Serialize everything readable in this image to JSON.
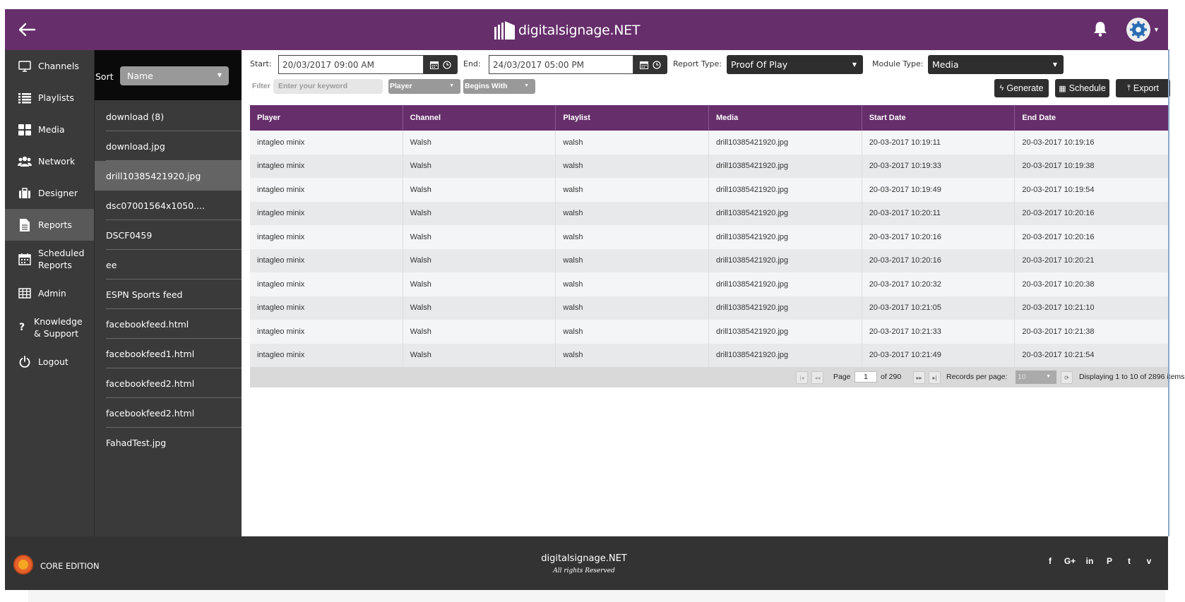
{
  "header": {
    "brand": "digitalsignage.NET"
  },
  "nav": {
    "items": [
      {
        "label": "Channels",
        "icon": "monitor-icon"
      },
      {
        "label": "Playlists",
        "icon": "list-icon"
      },
      {
        "label": "Media",
        "icon": "grid-icon"
      },
      {
        "label": "Network",
        "icon": "users-icon"
      },
      {
        "label": "Designer",
        "icon": "briefcase-icon"
      },
      {
        "label": "Reports",
        "icon": "file-icon",
        "active": true
      },
      {
        "label": "Scheduled",
        "label2": "Reports",
        "icon": "calendar-icon"
      },
      {
        "label": "Admin",
        "icon": "table-icon"
      },
      {
        "label": "Knowledge",
        "label2": "& Support",
        "icon": "question-icon"
      },
      {
        "label": "Logout",
        "icon": "power-icon"
      }
    ]
  },
  "list": {
    "sort_label": "Sort",
    "sort_value": "Name",
    "items": [
      "download (8)",
      "download.jpg",
      "drill10385421920.jpg",
      "dsc07001564x1050....",
      "DSCF0459",
      "ee",
      "ESPN Sports feed",
      "facebookfeed.html",
      "facebookfeed1.html",
      "facebookfeed2.html",
      "facebookfeed2.html",
      "FahadTest.jpg"
    ],
    "selected_index": 2
  },
  "filters": {
    "start_label": "Start:",
    "start_value": "20/03/2017 09:00 AM",
    "end_label": "End:",
    "end_value": "24/03/2017 05:00 PM",
    "report_type_label": "Report Type:",
    "report_type_value": "Proof Of Play",
    "module_type_label": "Module Type:",
    "module_type_value": "Media",
    "filter_label": "Filter",
    "filter_placeholder": "Enter your keyword",
    "field_value": "Player",
    "operator_value": "Begins With"
  },
  "actions": {
    "generate": "Generate",
    "schedule": "Schedule",
    "export": "Export"
  },
  "table": {
    "columns": [
      "Player",
      "Channel",
      "Playlist",
      "Media",
      "Start Date",
      "End Date"
    ],
    "rows": [
      [
        "intagleo minix",
        "Walsh",
        "walsh",
        "drill10385421920.jpg",
        "20-03-2017 10:19:11",
        "20-03-2017 10:19:16"
      ],
      [
        "intagleo minix",
        "Walsh",
        "walsh",
        "drill10385421920.jpg",
        "20-03-2017 10:19:33",
        "20-03-2017 10:19:38"
      ],
      [
        "intagleo minix",
        "Walsh",
        "walsh",
        "drill10385421920.jpg",
        "20-03-2017 10:19:49",
        "20-03-2017 10:19:54"
      ],
      [
        "intagleo minix",
        "Walsh",
        "walsh",
        "drill10385421920.jpg",
        "20-03-2017 10:20:11",
        "20-03-2017 10:20:16"
      ],
      [
        "intagleo minix",
        "Walsh",
        "walsh",
        "drill10385421920.jpg",
        "20-03-2017 10:20:16",
        "20-03-2017 10:20:16"
      ],
      [
        "intagleo minix",
        "Walsh",
        "walsh",
        "drill10385421920.jpg",
        "20-03-2017 10:20:16",
        "20-03-2017 10:20:21"
      ],
      [
        "intagleo minix",
        "Walsh",
        "walsh",
        "drill10385421920.jpg",
        "20-03-2017 10:20:32",
        "20-03-2017 10:20:38"
      ],
      [
        "intagleo minix",
        "Walsh",
        "walsh",
        "drill10385421920.jpg",
        "20-03-2017 10:21:05",
        "20-03-2017 10:21:10"
      ],
      [
        "intagleo minix",
        "Walsh",
        "walsh",
        "drill10385421920.jpg",
        "20-03-2017 10:21:33",
        "20-03-2017 10:21:38"
      ],
      [
        "intagleo minix",
        "Walsh",
        "walsh",
        "drill10385421920.jpg",
        "20-03-2017 10:21:49",
        "20-03-2017 10:21:54"
      ]
    ]
  },
  "pager": {
    "page_label": "Page",
    "page_value": "1",
    "of_label": "of 290",
    "rpp_label": "Records per page:",
    "rpp_value": "10",
    "displaying": "Displaying 1 to 10 of 2896 items"
  },
  "footer": {
    "edition": "CORE EDITION",
    "brand": "digitalsignage.NET",
    "rights": "All rights Reserved",
    "social": [
      "f",
      "G+",
      "in",
      "P",
      "t",
      "v"
    ]
  },
  "colors": {
    "brand_purple": "#662e6b",
    "nav_bg": "#3a3a3a",
    "footer_bg": "#333333",
    "accent_orange": "#e8622c"
  }
}
